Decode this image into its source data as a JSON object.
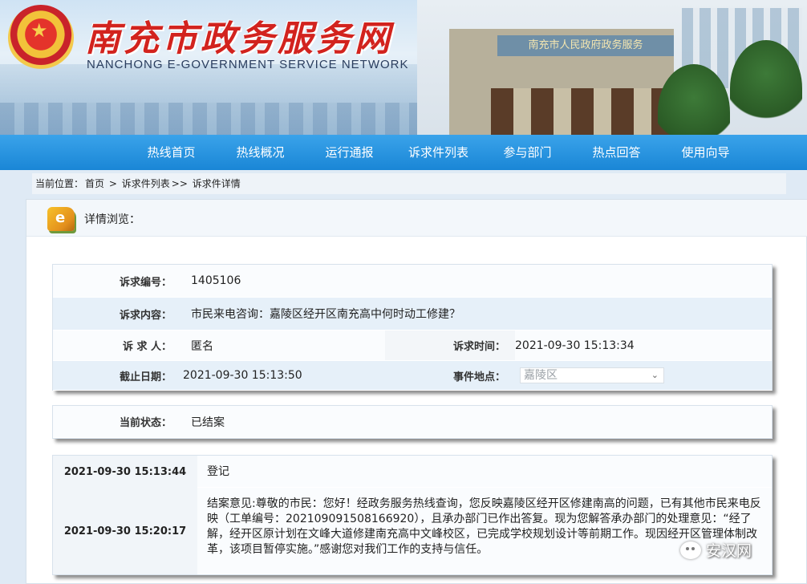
{
  "header": {
    "site_title": "南充市政务服务网",
    "site_subtitle": "NANCHONG E-GOVERNMENT SERVICE NETWORK",
    "building_sign": "南充市人民政府政务服务"
  },
  "nav": {
    "items": [
      "热线首页",
      "热线概况",
      "运行通报",
      "诉求件列表",
      "参与部门",
      "热点回答",
      "使用向导"
    ]
  },
  "breadcrumb": {
    "prefix": "当前位置：",
    "home": "首页",
    "sep1": ">",
    "list": "诉求件列表",
    "sep2": ">>",
    "current": "诉求件详情"
  },
  "panel": {
    "title": "详情浏览："
  },
  "detail": {
    "id_label": "诉求编号：",
    "id_value": "1405106",
    "content_label": "诉求内容：",
    "content_value": "市民来电咨询：嘉陵区经开区南充高中何时动工修建？",
    "person_label": "诉 求 人：",
    "person_value": "匿名",
    "time_label": "诉求时间：",
    "time_value": "2021-09-30 15:13:34",
    "deadline_label": "截止日期：",
    "deadline_value": "2021-09-30 15:13:50",
    "location_label": "事件地点：",
    "location_value": "嘉陵区"
  },
  "status": {
    "label": "当前状态：",
    "value": "已结案"
  },
  "log": [
    {
      "time": "2021-09-30 15:13:44",
      "text": "登记"
    },
    {
      "time": "2021-09-30 15:20:17",
      "text": "结案意见:尊敬的市民：您好！经政务服务热线查询，您反映嘉陵区经开区修建南高的问题，已有其他市民来电反映（工单编号：202109091508166920），且承办部门已作出答复。现为您解答承办部门的处理意见：“经了解，经开区原计划在文峰大道修建南充高中文峰校区，已完成学校规划设计等前期工作。现因经开区管理体制改革，该项目暂停实施。”感谢您对我们工作的支持与信任。"
    }
  ],
  "watermark": {
    "text": "安汉网"
  },
  "colors": {
    "nav_bg": "#1a86d6",
    "title_red": "#d2231e",
    "row_blue": "#e6f0f9"
  }
}
